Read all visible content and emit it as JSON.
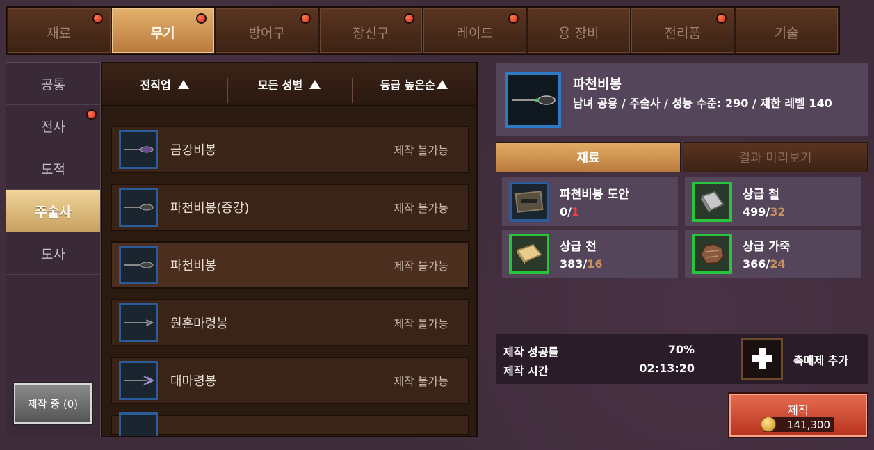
{
  "top_tabs": [
    {
      "label": "재료",
      "active": false,
      "alert": true
    },
    {
      "label": "무기",
      "active": true,
      "alert": true
    },
    {
      "label": "방어구",
      "active": false,
      "alert": true
    },
    {
      "label": "장신구",
      "active": false,
      "alert": true
    },
    {
      "label": "레이드",
      "active": false,
      "alert": true
    },
    {
      "label": "용 장비",
      "active": false,
      "alert": false
    },
    {
      "label": "전리품",
      "active": false,
      "alert": true
    },
    {
      "label": "기술",
      "active": false,
      "alert": false
    }
  ],
  "categories": [
    {
      "label": "공통",
      "active": false,
      "alert": false
    },
    {
      "label": "전사",
      "active": false,
      "alert": true
    },
    {
      "label": "도적",
      "active": false,
      "alert": false
    },
    {
      "label": "주술사",
      "active": true,
      "alert": false
    },
    {
      "label": "도사",
      "active": false,
      "alert": false
    }
  ],
  "making_button": "제작 중 (0)",
  "sort_header": {
    "job": "전직업",
    "gender": "모든 성별",
    "grade": "등급 높은순"
  },
  "recipes": [
    {
      "name": "금강비봉",
      "status": "제작 불가능",
      "selected": false,
      "icon": "staff-icon"
    },
    {
      "name": "파천비봉(증강)",
      "status": "제작 불가능",
      "selected": false,
      "icon": "staff-icon"
    },
    {
      "name": "파천비봉",
      "status": "제작 불가능",
      "selected": true,
      "icon": "staff-icon"
    },
    {
      "name": "원혼마령봉",
      "status": "제작 불가능",
      "selected": false,
      "icon": "staff-icon"
    },
    {
      "name": "대마령봉",
      "status": "제작 불가능",
      "selected": false,
      "icon": "staff-icon"
    }
  ],
  "detail": {
    "title": "파천비봉",
    "subtitle": "남녀 공용 / 주술사 / 성능 수준: 290 / 제한 레벨 140"
  },
  "sub_tabs": {
    "materials": "재료",
    "preview": "결과 미리보기"
  },
  "materials": [
    {
      "name": "파천비봉 도안",
      "have": "0",
      "need": "1",
      "shortage": true,
      "icon": "blueprint-icon"
    },
    {
      "name": "상급 철",
      "have": "499",
      "need": "32",
      "shortage": false,
      "icon": "iron-ingot-icon"
    },
    {
      "name": "상급 천",
      "have": "383",
      "need": "16",
      "shortage": false,
      "icon": "cloth-icon"
    },
    {
      "name": "상급 가죽",
      "have": "366",
      "need": "24",
      "shortage": false,
      "icon": "leather-icon"
    }
  ],
  "stats": {
    "success_label": "제작 성공률",
    "success_value": "70%",
    "time_label": "제작 시간",
    "time_value": "02:13:20"
  },
  "catalyst_label": "촉매제 추가",
  "craft": {
    "label": "제작",
    "price": "141,300"
  },
  "colors": {
    "accent": "#c88f4e",
    "alert": "#d42a10",
    "craft": "#c8452c",
    "rare_border": "#2b5c9a",
    "common_border": "#28c53c"
  }
}
